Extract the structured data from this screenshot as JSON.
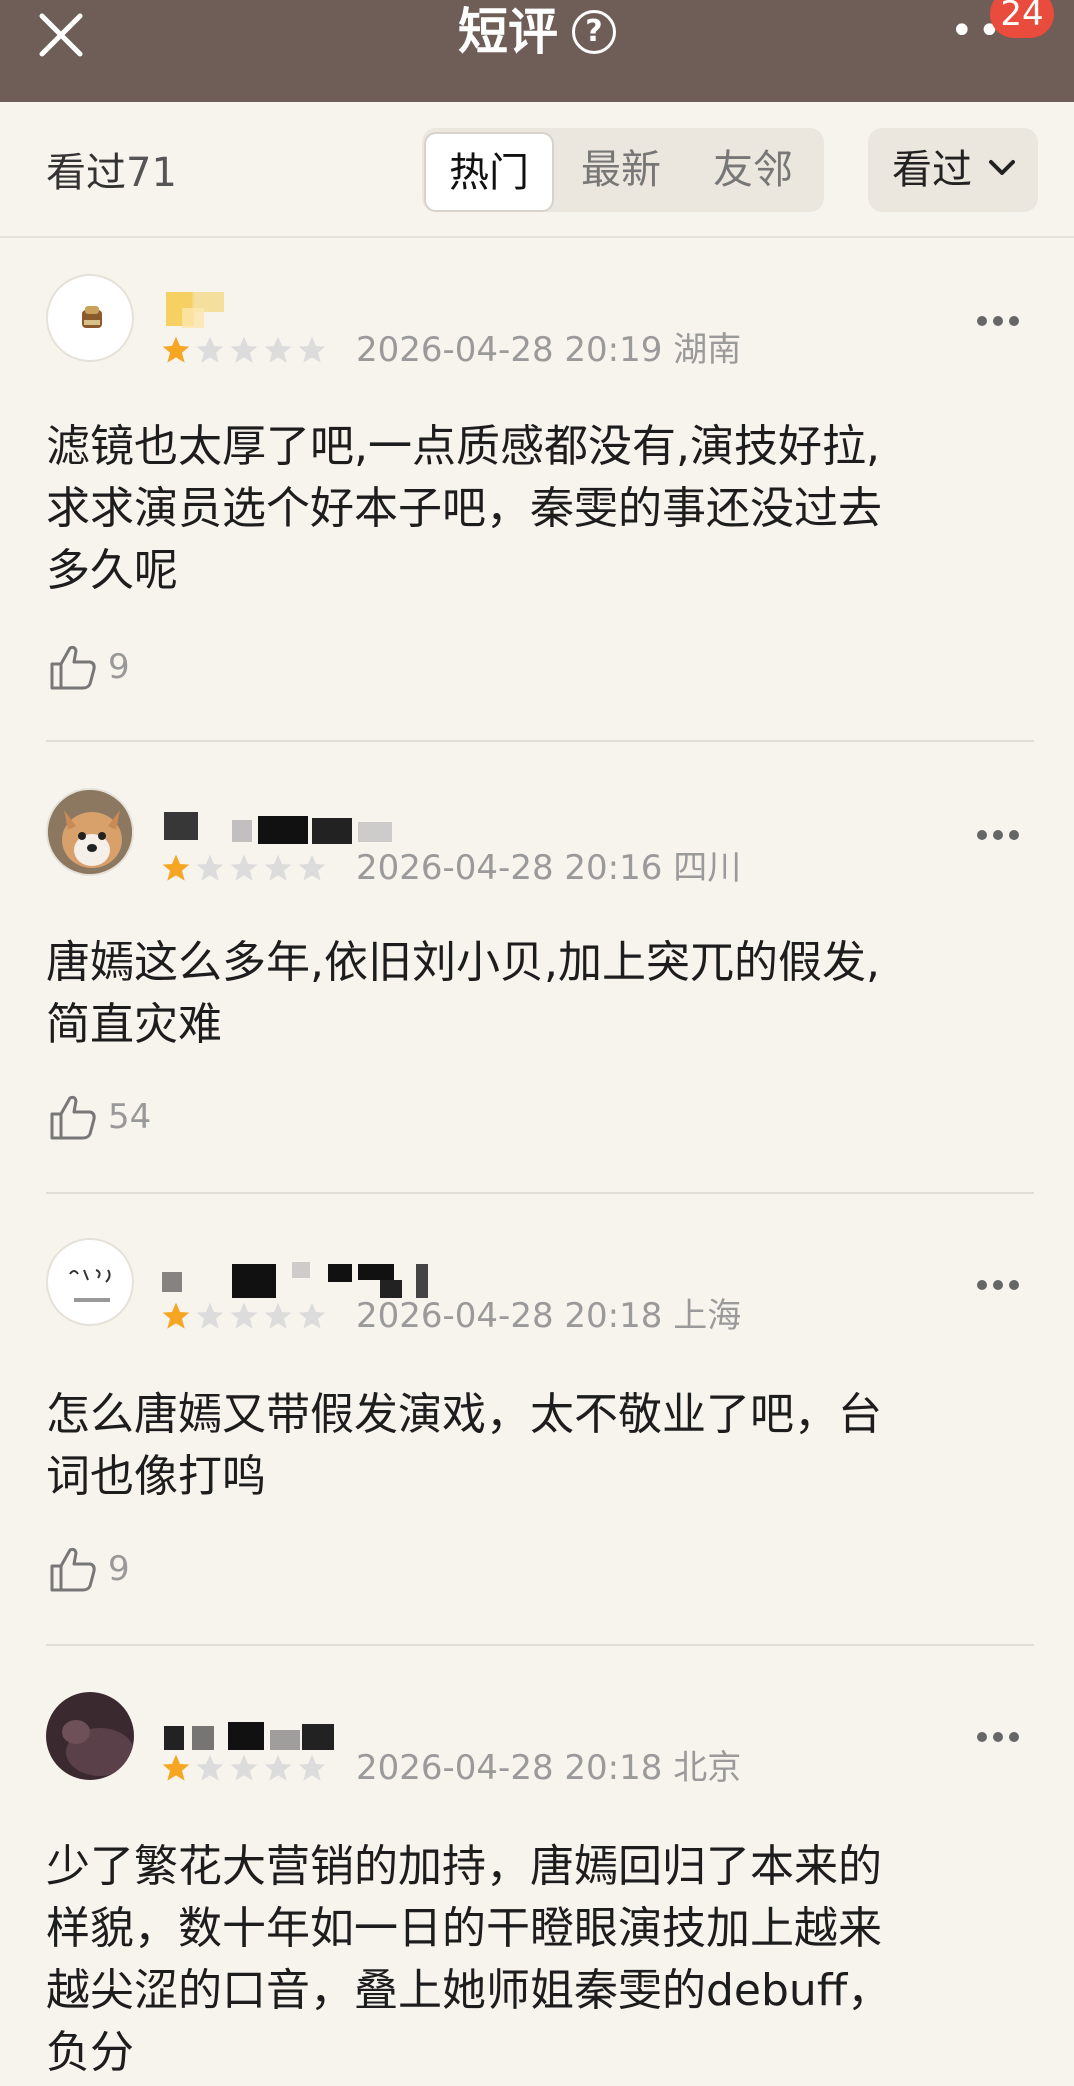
{
  "header": {
    "title": "短评",
    "help_icon": "?",
    "badge": "24",
    "close_icon": "close-icon",
    "more_icon": "more-icon"
  },
  "filter": {
    "seen_label": "看过",
    "seen_count": "71",
    "tabs": [
      {
        "label": "热门",
        "active": true
      },
      {
        "label": "最新",
        "active": false
      },
      {
        "label": "友邻",
        "active": false
      }
    ],
    "sort_label": "看过"
  },
  "comments": [
    {
      "rating": 1,
      "date": "2026-04-28 20:19",
      "location": "湖南",
      "lines": [
        "滤镜也太厚了吧,一点质感都没有,演技好拉,",
        "求求演员选个好本子吧，秦雯的事还没过去",
        "多久呢"
      ],
      "likes": "9"
    },
    {
      "rating": 1,
      "date": "2026-04-28 20:16",
      "location": "四川",
      "lines": [
        "唐嫣这么多年,依旧刘小贝,加上突兀的假发,",
        "简直灾难"
      ],
      "likes": "54"
    },
    {
      "rating": 1,
      "date": "2026-04-28 20:18",
      "location": "上海",
      "lines": [
        "怎么唐嫣又带假发演戏，太不敬业了吧，台",
        "词也像打鸣"
      ],
      "likes": "9"
    },
    {
      "rating": 1,
      "date": "2026-04-28 20:18",
      "location": "北京",
      "lines": [
        "少了繁花大营销的加持，唐嫣回归了本来的",
        "样貌，数十年如一日的干瞪眼演技加上越来",
        "越尖涩的口音，叠上她师姐秦雯的debuff，",
        "负分"
      ],
      "likes": ""
    }
  ],
  "colors": {
    "topbar": "#6f5e57",
    "background": "#f7f4ee",
    "star_on": "#f5a623",
    "star_off": "#dcdcdc",
    "badge": "#e94b3c"
  }
}
